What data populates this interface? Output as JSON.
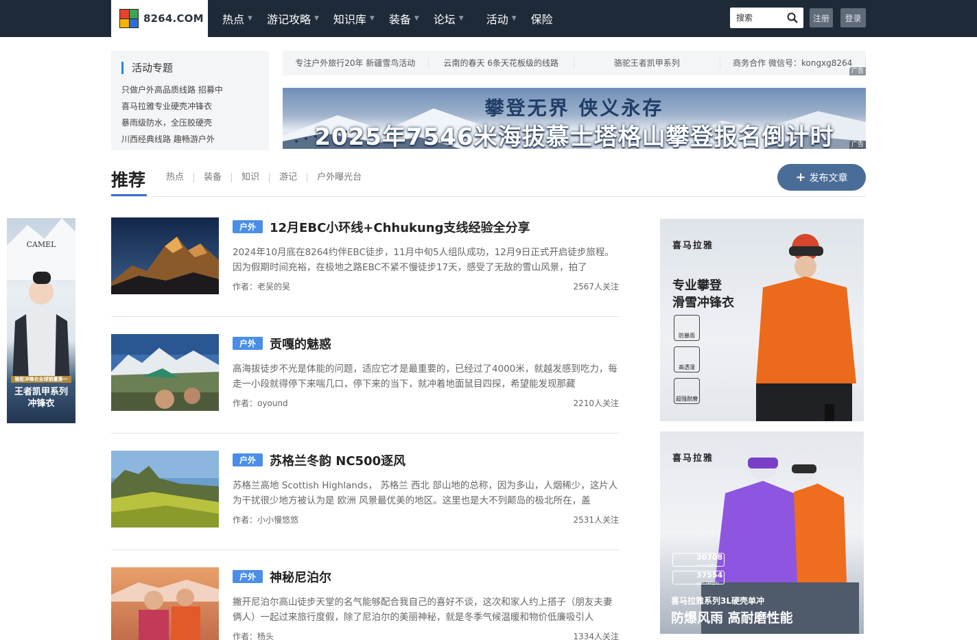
{
  "logo": {
    "text": "8264.COM"
  },
  "nav": [
    {
      "label": "热点",
      "dropdown": true
    },
    {
      "label": "游记攻略",
      "dropdown": true
    },
    {
      "label": "知识库",
      "dropdown": true
    },
    {
      "label": "装备",
      "dropdown": true
    },
    {
      "label": "论坛",
      "dropdown": true
    },
    {
      "label": "活动",
      "dropdown": true
    },
    {
      "label": "保险",
      "dropdown": false
    }
  ],
  "search": {
    "placeholder": "搜索"
  },
  "auth": {
    "register": "注册",
    "login": "登录"
  },
  "activity": {
    "title": "活动专题",
    "links": [
      "只做户外高品质线路 招募中",
      "喜马拉雅专业硬壳冲锋衣",
      "暴雨级防水，全压胶硬壳",
      "川西经典线路 趣畅游户外"
    ]
  },
  "ad_links": [
    "专注户外旅行20年 新疆雪鸟活动",
    "云南的春天 6条天花板级的线路",
    "骆驼王者凯甲系列",
    "商务合作 微信号：kongxg8264"
  ],
  "ad_tag": "广告",
  "banner": {
    "line1": "攀登无界 侠义永存",
    "line2": "2025年7546米海拔慕士塔格山攀登报名倒计时"
  },
  "section": {
    "title": "推荐",
    "tabs": [
      "热点",
      "装备",
      "知识",
      "游记",
      "户外曝光台"
    ],
    "publish_label": "发布文章"
  },
  "articles": [
    {
      "badge": "户外",
      "title": "12月EBC小环线+Chhukung支线经验全分享",
      "desc": "2024年10月底在8264约伴EBC徒步，11月中旬5人组队成功，12月9日正式开启徒步旅程。因为假期时间充裕，在极地之路EBC不紧不慢徒步17天，感受了无敌的雪山风景，拍了",
      "author": "作者：老吴的吴",
      "follow": "2567人关注"
    },
    {
      "badge": "户外",
      "title": "贡嘎的魅惑",
      "desc": "高海拔徒步不光是体能的问题，适应它才是最重要的，已经过了4000米，就越发感到吃力，每走一小段就得停下来喘几口，停下来的当下，就冲着地面鼠目四探，希望能发现那藏",
      "author": "作者：oyound",
      "follow": "2210人关注"
    },
    {
      "badge": "户外",
      "title": "苏格兰冬韵 NC500逐风",
      "desc": "苏格兰高地 Scottish Highlands， 苏格兰 西北 部山地的总称，因为多山，人烟稀少，这片人为干扰很少地方被认为是 欧洲 风景最优美的地区。这里也是大不列颠岛的极北所在，盖",
      "author": "作者：小小慢悠悠",
      "follow": "2531人关注"
    },
    {
      "badge": "户外",
      "title": "神秘尼泊尔",
      "desc": "撇开尼泊尔高山徒步天堂的名气能够配合我自己的喜好不谈，这次和家人约上搭子（朋友夫妻俩人）一起过来旅行度假，除了尼泊尔的美丽神秘，就是冬季气候温暖和物价低廉吸引人",
      "author": "作者：杨头",
      "follow": "1334人关注"
    }
  ],
  "left_ad": {
    "brand": "CAMEL",
    "tagline": "骆驼冲锋衣全球销量第一",
    "line1": "王者凯甲系列",
    "line2": "冲锋衣"
  },
  "right_ad1": {
    "brand": "喜马拉雅",
    "line1": "专业攀登",
    "line2": "滑雪冲锋衣",
    "features": [
      "防暴雨",
      "高透湿",
      "超强耐磨"
    ]
  },
  "right_ad2": {
    "brand": "喜马拉雅",
    "spec1": "30708",
    "spec1_unit": "mmH₂O(JIS)",
    "spec2": "37554",
    "spec2_unit": "g/m²·24h(JIS)",
    "line1": "喜马拉雅系列3L硬壳单冲",
    "line2": "防爆风雨 高耐磨性能"
  }
}
